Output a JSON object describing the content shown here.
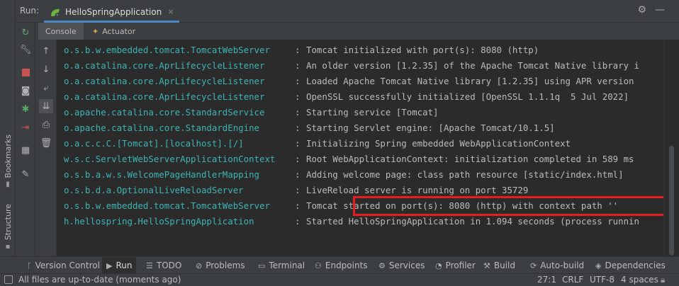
{
  "run_bar": {
    "label": "Run:",
    "tab_label": "HelloSpringApplication",
    "close_symbol": "×",
    "settings_icon": "gear-icon",
    "hide_icon": "minimize-icon"
  },
  "sub_tabs": [
    {
      "label": "Console",
      "active": true
    },
    {
      "label": "Actuator",
      "active": false,
      "icon": "actuator-icon"
    }
  ],
  "gutter": {
    "bookmarks_label": "Bookmarks",
    "structure_label": "Structure"
  },
  "toolbar_left": [
    "rerun-icon",
    "wrench-icon",
    "stop-icon",
    "camera-icon",
    "debug-bug-icon",
    "exit-icon",
    "layout-icon",
    "pin-icon"
  ],
  "toolbar_console": [
    "scroll-up-icon",
    "scroll-down-icon",
    "soft-wrap-icon",
    "scroll-to-end-icon",
    "print-icon",
    "trash-icon"
  ],
  "log": [
    {
      "logger": "o.s.b.w.embedded.tomcat.TomcatWebServer",
      "sep": ":",
      "message": "Tomcat initialized with port(s): 8080 (http)"
    },
    {
      "logger": "o.a.catalina.core.AprLifecycleListener",
      "sep": ":",
      "message": "An older version [1.2.35] of the Apache Tomcat Native library i"
    },
    {
      "logger": "o.a.catalina.core.AprLifecycleListener",
      "sep": ":",
      "message": "Loaded Apache Tomcat Native library [1.2.35] using APR version"
    },
    {
      "logger": "o.a.catalina.core.AprLifecycleListener",
      "sep": ":",
      "message": "OpenSSL successfully initialized [OpenSSL 1.1.1q  5 Jul 2022]"
    },
    {
      "logger": "o.apache.catalina.core.StandardService",
      "sep": ":",
      "message": "Starting service [Tomcat]"
    },
    {
      "logger": "o.apache.catalina.core.StandardEngine",
      "sep": ":",
      "message": "Starting Servlet engine: [Apache Tomcat/10.1.5]"
    },
    {
      "logger": "o.a.c.c.C.[Tomcat].[localhost].[/]",
      "sep": ":",
      "message": "Initializing Spring embedded WebApplicationContext"
    },
    {
      "logger": "w.s.c.ServletWebServerApplicationContext",
      "sep": ":",
      "message": "Root WebApplicationContext: initialization completed in 589 ms"
    },
    {
      "logger": "o.s.b.a.w.s.WelcomePageHandlerMapping",
      "sep": ":",
      "message": "Adding welcome page: class path resource [static/index.html]"
    },
    {
      "logger": "o.s.b.d.a.OptionalLiveReloadServer",
      "sep": ":",
      "message": "LiveReload server is running on port 35729"
    },
    {
      "logger": "o.s.b.w.embedded.tomcat.TomcatWebServer",
      "sep": ":",
      "message": "Tomcat started on port(s): 8080 (http) with context path ''"
    },
    {
      "logger": "h.hellospring.HelloSpringApplication",
      "sep": ":",
      "message": "Started HelloSpringApplication in 1.094 seconds (process runnin"
    }
  ],
  "highlighted_line_index": 10,
  "tool_windows": [
    {
      "label": "Version Control",
      "icon": "version-control-icon",
      "active": false
    },
    {
      "label": "Run",
      "icon": "run-icon",
      "active": true
    },
    {
      "label": "TODO",
      "icon": "todo-icon",
      "active": false
    },
    {
      "label": "Problems",
      "icon": "problems-icon",
      "active": false
    },
    {
      "label": "Terminal",
      "icon": "terminal-icon",
      "active": false
    },
    {
      "label": "Endpoints",
      "icon": "endpoints-icon",
      "active": false
    },
    {
      "label": "Services",
      "icon": "services-icon",
      "active": false
    },
    {
      "label": "Profiler",
      "icon": "profiler-icon",
      "active": false
    },
    {
      "label": "Build",
      "icon": "build-icon",
      "active": false
    },
    {
      "label": "Auto-build",
      "icon": "auto-build-icon",
      "active": false
    },
    {
      "label": "Dependencies",
      "icon": "dependencies-icon",
      "active": false
    }
  ],
  "status": {
    "message": "All files are up-to-date (moments ago)",
    "cursor": "27:1",
    "line_separator": "CRLF",
    "encoding": "UTF-8",
    "indent": "4 spaces"
  },
  "colors": {
    "logger": "#3fb3b3",
    "message": "#bbbbbb",
    "highlight": "#e81d1d",
    "accent": "#4a88c7"
  }
}
